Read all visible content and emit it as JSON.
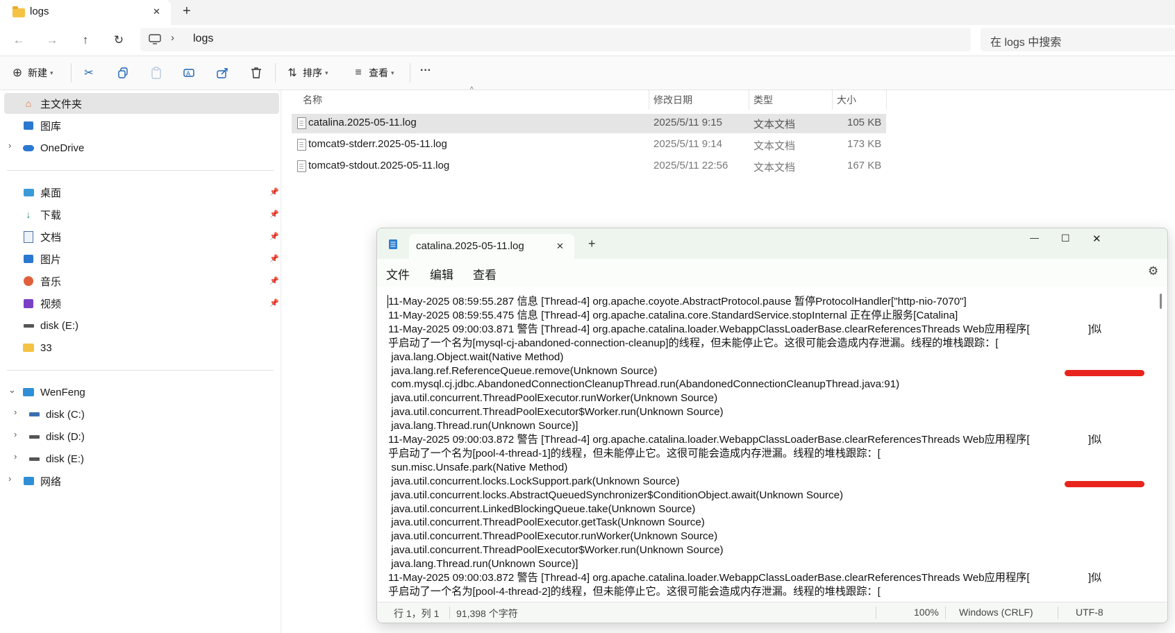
{
  "explorer": {
    "tab_title": "logs",
    "tab_close": "✕",
    "new_tab": "+",
    "breadcrumb": "logs",
    "search_placeholder": "在 logs 中搜索",
    "commands": {
      "new": "新建",
      "sort": "排序",
      "view": "查看",
      "more": "···"
    },
    "nav": {
      "quick": [
        {
          "label": "主文件夹",
          "icon": "home-icon"
        },
        {
          "label": "图库",
          "icon": "gallery-icon"
        },
        {
          "label": "OneDrive",
          "icon": "cloud-icon"
        }
      ],
      "pinned": [
        {
          "label": "桌面",
          "icon": "desktop-icon"
        },
        {
          "label": "下载",
          "icon": "download-icon"
        },
        {
          "label": "文档",
          "icon": "document-icon"
        },
        {
          "label": "图片",
          "icon": "picture-icon"
        },
        {
          "label": "音乐",
          "icon": "music-icon"
        },
        {
          "label": "视频",
          "icon": "video-icon"
        },
        {
          "label": "disk (E:)",
          "icon": "drive-icon"
        },
        {
          "label": "33",
          "icon": "folder-icon"
        }
      ],
      "pc": "WenFeng",
      "drives": [
        "disk (C:)",
        "disk (D:)",
        "disk (E:)"
      ],
      "network": "网络"
    },
    "columns": {
      "name": "名称",
      "modified": "修改日期",
      "type": "类型",
      "size": "大小"
    },
    "files": [
      {
        "name": "catalina.2025-05-11.log",
        "modified": "2025/5/11 9:15",
        "type": "文本文档",
        "size": "105 KB",
        "selected": true
      },
      {
        "name": "tomcat9-stderr.2025-05-11.log",
        "modified": "2025/5/11 9:14",
        "type": "文本文档",
        "size": "173 KB",
        "selected": false
      },
      {
        "name": "tomcat9-stdout.2025-05-11.log",
        "modified": "2025/5/11 22:56",
        "type": "文本文档",
        "size": "167 KB",
        "selected": false
      }
    ]
  },
  "notepad": {
    "tab_title": "catalina.2025-05-11.log",
    "tab_close": "✕",
    "new_tab": "+",
    "window_buttons": {
      "minimize": "—",
      "maximize": "☐",
      "close": "✕"
    },
    "menu": {
      "file": "文件",
      "edit": "编辑",
      "view": "查看"
    },
    "lines": [
      "11-May-2025 08:59:55.287 信息 [Thread-4] org.apache.coyote.AbstractProtocol.pause 暂停ProtocolHandler[\"http-nio-7070\"]",
      "11-May-2025 08:59:55.475 信息 [Thread-4] org.apache.catalina.core.StandardService.stopInternal 正在停止服务[Catalina]",
      "11-May-2025 09:00:03.871 警告 [Thread-4] org.apache.catalina.loader.WebappClassLoaderBase.clearReferencesThreads Web应用程序[                    ]似",
      "乎启动了一个名为[mysql-cj-abandoned-connection-cleanup]的线程，但未能停止它。这很可能会造成内存泄漏。线程的堆栈跟踪：[",
      " java.lang.Object.wait(Native Method)",
      " java.lang.ref.ReferenceQueue.remove(Unknown Source)",
      " com.mysql.cj.jdbc.AbandonedConnectionCleanupThread.run(AbandonedConnectionCleanupThread.java:91)",
      " java.util.concurrent.ThreadPoolExecutor.runWorker(Unknown Source)",
      " java.util.concurrent.ThreadPoolExecutor$Worker.run(Unknown Source)",
      " java.lang.Thread.run(Unknown Source)]",
      "11-May-2025 09:00:03.872 警告 [Thread-4] org.apache.catalina.loader.WebappClassLoaderBase.clearReferencesThreads Web应用程序[                    ]似",
      "乎启动了一个名为[pool-4-thread-1]的线程，但未能停止它。这很可能会造成内存泄漏。线程的堆栈跟踪：[",
      " sun.misc.Unsafe.park(Native Method)",
      " java.util.concurrent.locks.LockSupport.park(Unknown Source)",
      " java.util.concurrent.locks.AbstractQueuedSynchronizer$ConditionObject.await(Unknown Source)",
      " java.util.concurrent.LinkedBlockingQueue.take(Unknown Source)",
      " java.util.concurrent.ThreadPoolExecutor.getTask(Unknown Source)",
      " java.util.concurrent.ThreadPoolExecutor.runWorker(Unknown Source)",
      " java.util.concurrent.ThreadPoolExecutor$Worker.run(Unknown Source)",
      " java.lang.Thread.run(Unknown Source)]",
      "11-May-2025 09:00:03.872 警告 [Thread-4] org.apache.catalina.loader.WebappClassLoaderBase.clearReferencesThreads Web应用程序[                    ]似",
      "乎启动了一个名为[pool-4-thread-2]的线程，但未能停止它。这很可能会造成内存泄漏。线程的堆栈跟踪：["
    ],
    "status": {
      "position": "行 1，列 1",
      "chars": "91,398 个字符",
      "zoom": "100%",
      "line_ending": "Windows (CRLF)",
      "encoding": "UTF-8"
    }
  }
}
